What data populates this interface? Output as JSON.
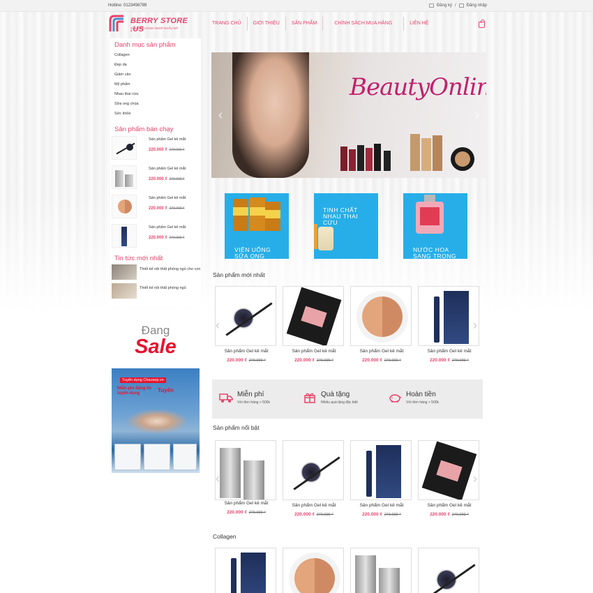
{
  "topbar": {
    "hotline": "Hotline: 0123456789",
    "register": "Đăng ký",
    "separator": "/",
    "login": "Đăng nhập"
  },
  "logo": {
    "name": "BERRY STORE .US",
    "tagline": "CHUYÊN HÀNG NHẬP KHẨU MỸ"
  },
  "nav": [
    "TRANG CHỦ",
    "GIỚI THIỆU",
    "SẢN PHẨM",
    "CHÍNH SÁCH MUA HÀNG",
    "LIÊN HỆ"
  ],
  "sidebar": {
    "categories_title": "Danh mục sản phẩm",
    "categories": [
      "Collagen",
      "Đẹp da",
      "Giảm cân",
      "Mỹ phẩm",
      "Nhau thai cừu",
      "Sữa ong chúa",
      "Sức khỏe"
    ],
    "bestseller_title": "Sản phẩm bán chạy",
    "bestsellers": [
      {
        "name": "Sản phẩm Gel kẻ mắt",
        "price": "220.000 ₫",
        "old_price": "270.000 ₫"
      },
      {
        "name": "Sản phẩm Gel kẻ mắt",
        "price": "220.000 ₫",
        "old_price": "270.000 ₫"
      },
      {
        "name": "Sản phẩm Gel kẻ mắt",
        "price": "220.000 ₫",
        "old_price": "270.000 ₫"
      },
      {
        "name": "Sản phẩm Gel kẻ mắt",
        "price": "220.000 ₫",
        "old_price": "270.000 ₫"
      }
    ],
    "news_title": "Tin tức mới nhất",
    "news": [
      {
        "title": "Thiết kế nội thất phòng ngủ cho con"
      },
      {
        "title": "Thiết kế nội thất phòng ngủ"
      }
    ],
    "sale_word": "Đang",
    "sale_big": "Sale",
    "recruit_tag": "Tuyển dụng Chaosep.vn",
    "recruit_line": "Miễn phí đăng tin tuyển dụng",
    "recruit_word": "Tuyển"
  },
  "slider": {
    "title": "BeautyOnline"
  },
  "tiles": [
    {
      "text": "VIÊN UỐNG SỮA ONG"
    },
    {
      "text": "TINH CHẤT NHAU THAI CỪU"
    },
    {
      "text": "NƯỚC HOA SANG TRỌNG"
    }
  ],
  "sections": {
    "new_title": "Sản phẩm mới nhất",
    "featured_title": "Sản phẩm nổi bật",
    "collagen_title": "Collagen"
  },
  "new_products": [
    {
      "name": "Sản phẩm Gel kẻ mắt",
      "price": "220.000 ₫",
      "old_price": "270.000 ₫"
    },
    {
      "name": "Sản phẩm Gel kẻ mắt",
      "price": "220.000 ₫",
      "old_price": "270.000 ₫"
    },
    {
      "name": "Sản phẩm Gel kẻ mắt",
      "price": "220.000 ₫",
      "old_price": "270.000 ₫"
    },
    {
      "name": "Sản phẩm Gel kẻ mắt",
      "price": "220.000 ₫",
      "old_price": "270.000 ₫"
    }
  ],
  "services": [
    {
      "title": "Miễn phí",
      "sub": "Với đơn hàng > 500k",
      "icon": "truck-icon"
    },
    {
      "title": "Quà tặng",
      "sub": "Nhiều quà tặng đặc biệt",
      "icon": "gift-icon"
    },
    {
      "title": "Hoàn tiền",
      "sub": "Với đơn hàng > 500k",
      "icon": "piggy-bank-icon"
    }
  ],
  "featured_products": [
    {
      "name": "Sản phẩm Gel kẻ mắt",
      "price": "220.000 ₫",
      "old_price": "270.000 ₫"
    },
    {
      "name": "Sản phẩm Gel kẻ mắt",
      "price": "220.000 ₫",
      "old_price": "270.000 ₫"
    },
    {
      "name": "Sản phẩm Gel kẻ mắt",
      "price": "220.000 ₫",
      "old_price": "270.000 ₫"
    },
    {
      "name": "Sản phẩm Gel kẻ mắt",
      "price": "220.000 ₫",
      "old_price": "270.000 ₫"
    }
  ],
  "colors": {
    "accent": "#e8436a",
    "tile": "#27aee8",
    "sale": "#e5142f"
  }
}
